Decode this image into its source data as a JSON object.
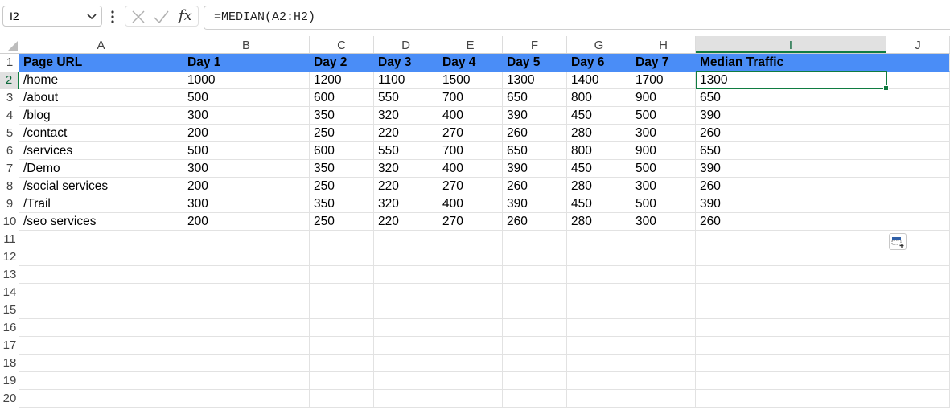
{
  "formula_bar": {
    "name_box": "I2",
    "formula": "=MEDIAN(A2:H2)"
  },
  "columns": [
    "A",
    "B",
    "C",
    "D",
    "E",
    "F",
    "G",
    "H",
    "I",
    "J"
  ],
  "rows": [
    "1",
    "2",
    "3",
    "4",
    "5",
    "6",
    "7",
    "8",
    "9",
    "10",
    "11",
    "12",
    "13",
    "14",
    "15",
    "16",
    "17",
    "18",
    "19",
    "20"
  ],
  "sheet": {
    "header": [
      "Page URL",
      "Day 1",
      "Day 2",
      "Day 3",
      "Day 4",
      "Day 5",
      "Day 6",
      "Day 7",
      "Median Traffic"
    ],
    "data": [
      [
        "/home",
        "1000",
        "1200",
        "1100",
        "1500",
        "1300",
        "1400",
        "1700",
        "1300"
      ],
      [
        "/about",
        "500",
        "600",
        "550",
        "700",
        "650",
        "800",
        "900",
        "650"
      ],
      [
        "/blog",
        "300",
        "350",
        "320",
        "400",
        "390",
        "450",
        "500",
        "390"
      ],
      [
        "/contact",
        "200",
        "250",
        "220",
        "270",
        "260",
        "280",
        "300",
        "260"
      ],
      [
        "/services",
        "500",
        "600",
        "550",
        "700",
        "650",
        "800",
        "900",
        "650"
      ],
      [
        "/Demo",
        "300",
        "350",
        "320",
        "400",
        "390",
        "450",
        "500",
        "390"
      ],
      [
        "/social services",
        "200",
        "250",
        "220",
        "270",
        "260",
        "280",
        "300",
        "260"
      ],
      [
        "/Trail",
        "300",
        "350",
        "320",
        "400",
        "390",
        "450",
        "500",
        "390"
      ],
      [
        "/seo services",
        "200",
        "250",
        "220",
        "270",
        "260",
        "280",
        "300",
        "260"
      ]
    ]
  },
  "colors": {
    "header_fill": "#4a8df7",
    "selection": "#107c41"
  }
}
